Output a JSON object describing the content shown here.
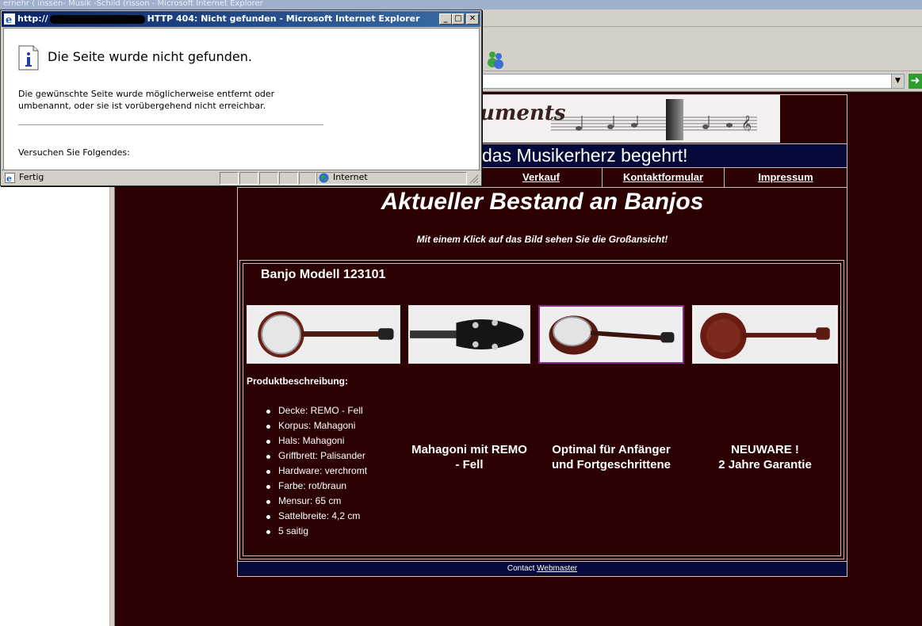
{
  "background_window": {
    "title": "ernehr ( inssen- Musik -Schild (risson - Microsoft Internet Explorer"
  },
  "popup": {
    "title_prefix": "http://",
    "title_suffix": "HTTP 404: Nicht gefunden - Microsoft Internet Explorer",
    "minimize_glyph": "_",
    "maximize_glyph": "□",
    "close_glyph": "✕",
    "error_heading": "Die Seite wurde nicht gefunden.",
    "error_text": "Die gewünschte Seite wurde möglicherweise entfernt oder umbenannt, oder sie ist vorübergehend nicht erreichbar.",
    "try_text": "Versuchen Sie Folgendes:",
    "status_text": "Fertig",
    "zone_text": "Internet"
  },
  "website": {
    "banner_text": "uments",
    "slogan": "das Musikerherz begehrt!",
    "nav": [
      "Verkauf",
      "Kontaktformular",
      "Impressum"
    ],
    "main_title": "Aktueller Bestand an Banjos",
    "subtitle": "Mit einem Klick auf das Bild sehen Sie die Großansicht!",
    "product_title": "Banjo Modell 123101",
    "description_heading": "Produktbeschreibung:",
    "specs": [
      "Decke: REMO - Fell",
      "Korpus: Mahagoni",
      "Hals: Mahagoni",
      "Griffbrett: Palisander",
      "Hardware: verchromt",
      "Farbe: rot/braun",
      "Mensur: 65 cm",
      "Sattelbreite: 4,2 cm",
      "5 saitig"
    ],
    "features": [
      {
        "line1": "Mahagoni mit REMO",
        "line2": "- Fell"
      },
      {
        "line1": "Optimal für Anfänger",
        "line2": "und Fortgeschrittene"
      },
      {
        "line1": "NEUWARE !",
        "line2": "2 Jahre Garantie"
      }
    ],
    "footer_prefix": "Contact",
    "footer_link": "Webmaster"
  },
  "colors": {
    "page_background": "#2b0102",
    "navy_bar": "#050a3a",
    "text": "#ffffff"
  }
}
